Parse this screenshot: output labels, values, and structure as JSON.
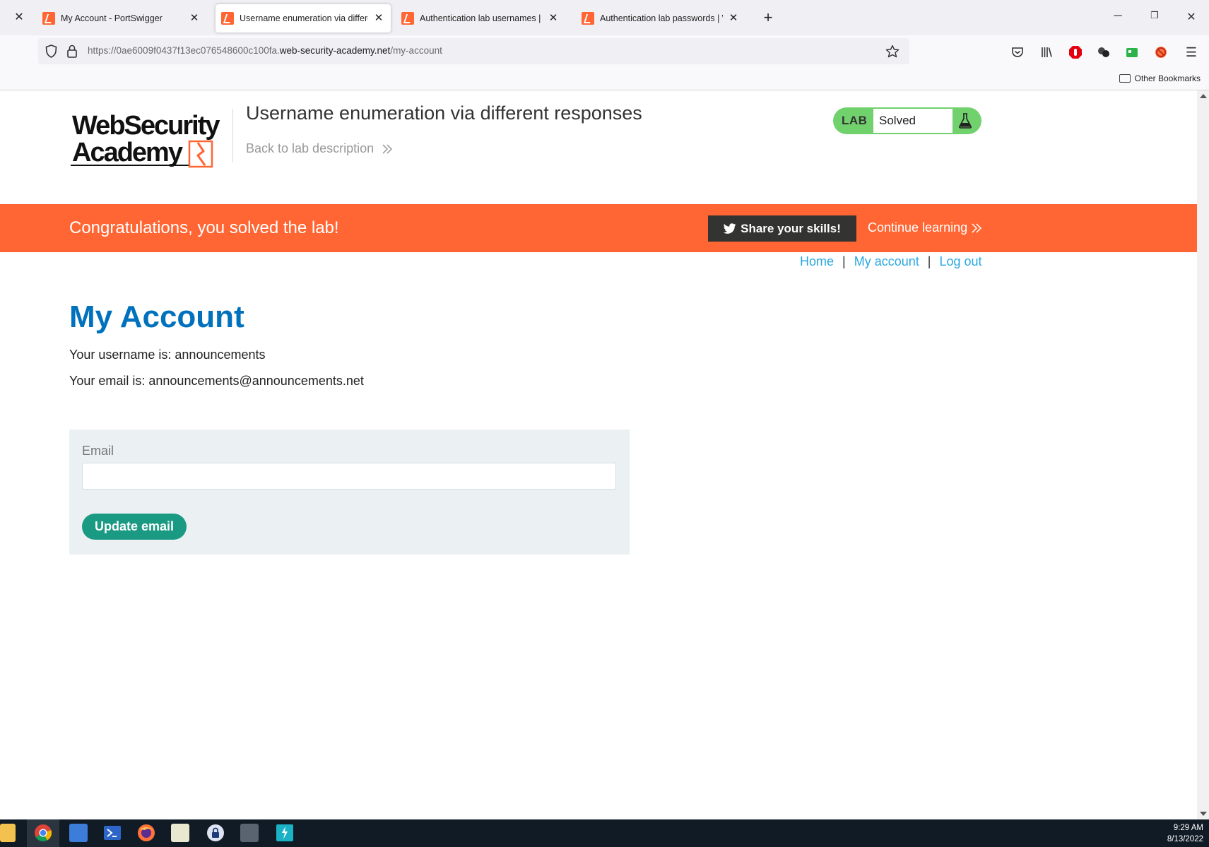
{
  "browser": {
    "tabs": [
      {
        "label": "My Account - PortSwigger",
        "active": false
      },
      {
        "label": "Username enumeration via different",
        "active": true
      },
      {
        "label": "Authentication lab usernames | Web",
        "active": false
      },
      {
        "label": "Authentication lab passwords | Web",
        "active": false
      }
    ],
    "url": {
      "prefix": "https://0ae6009f0437f13ec076548600c100fa.",
      "host": "web-security-academy.net",
      "path": "/my-account"
    },
    "bookmarks": {
      "other": "Other Bookmarks"
    }
  },
  "header": {
    "logo_line1": "WebSecurity",
    "logo_line2": "Academy",
    "lab_title": "Username enumeration via different responses",
    "back_link": "Back to lab description",
    "lab_badge": "LAB",
    "lab_status": "Solved"
  },
  "banner": {
    "message": "Congratulations, you solved the lab!",
    "share_label": "Share your skills!",
    "continue_label": "Continue learning"
  },
  "nav": {
    "home": "Home",
    "my_account": "My account",
    "log_out": "Log out",
    "separator": "|"
  },
  "account": {
    "heading": "My Account",
    "username_line": "Your username is: announcements",
    "email_line": "Your email is: announcements@announcements.net",
    "email_label": "Email",
    "email_value": "",
    "update_button": "Update email"
  },
  "taskbar": {
    "time": "9:29 AM",
    "date": "8/13/2022"
  },
  "colors": {
    "accent_orange": "#ff6633",
    "lab_green": "#70d16d",
    "heading_blue": "#0071bc",
    "link_blue": "#29a7df",
    "button_teal": "#1a9983",
    "form_bg": "#ebf0f2"
  }
}
